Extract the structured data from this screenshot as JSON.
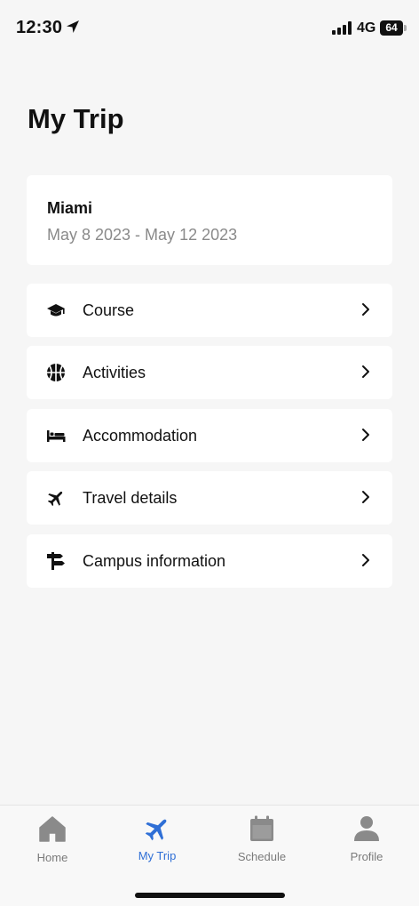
{
  "status_bar": {
    "time": "12:30",
    "network": "4G",
    "battery": "64"
  },
  "page": {
    "title": "My Trip"
  },
  "trip": {
    "city": "Miami",
    "dates": "May 8 2023 - May 12 2023"
  },
  "menu": {
    "items": [
      {
        "label": "Course",
        "icon": "graduation-cap-icon"
      },
      {
        "label": "Activities",
        "icon": "basketball-icon"
      },
      {
        "label": "Accommodation",
        "icon": "bed-icon"
      },
      {
        "label": "Travel details",
        "icon": "airplane-icon"
      },
      {
        "label": "Campus information",
        "icon": "signpost-icon"
      }
    ]
  },
  "tab_bar": {
    "active": "My Trip",
    "active_color": "#2f6fd6",
    "inactive_color": "#7a7a7a",
    "tabs": [
      {
        "label": "Home",
        "icon": "home-icon"
      },
      {
        "label": "My Trip",
        "icon": "airplane-icon"
      },
      {
        "label": "Schedule",
        "icon": "calendar-icon"
      },
      {
        "label": "Profile",
        "icon": "person-icon"
      }
    ]
  }
}
